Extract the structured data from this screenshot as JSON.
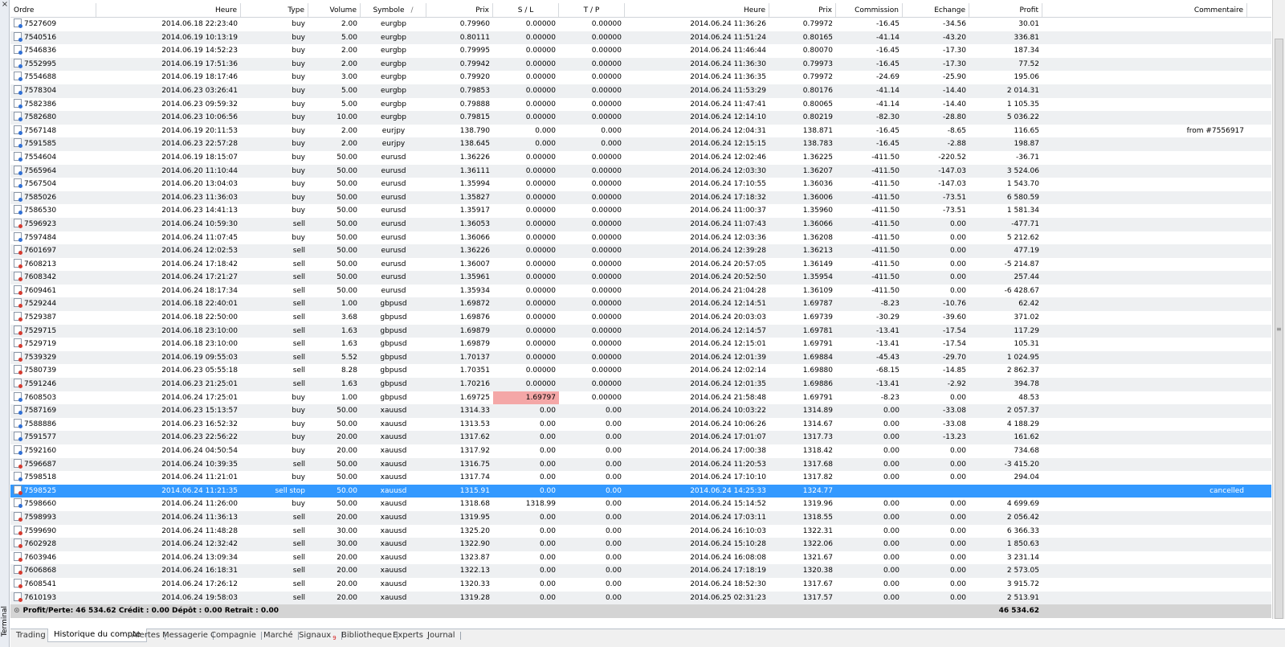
{
  "terminal_label": "Terminal",
  "columns": [
    "Ordre",
    "Heure",
    "Type",
    "Volume",
    "Symbole",
    "Prix",
    "S / L",
    "T / P",
    "Heure",
    "Prix",
    "Commission",
    "Echange",
    "Profit",
    "Commentaire"
  ],
  "rows": [
    {
      "order": "7527609",
      "open_time": "2014.06.18 22:23:40",
      "type": "buy",
      "volume": "2.00",
      "symbol": "eurgbp",
      "open_price": "0.79960",
      "sl": "0.00000",
      "tp": "0.00000",
      "close_time": "2014.06.24 11:36:26",
      "close_price": "0.79972",
      "commission": "-16.45",
      "swap": "-34.56",
      "profit": "30.01",
      "comment": ""
    },
    {
      "order": "7540516",
      "open_time": "2014.06.19 10:13:19",
      "type": "buy",
      "volume": "5.00",
      "symbol": "eurgbp",
      "open_price": "0.80111",
      "sl": "0.00000",
      "tp": "0.00000",
      "close_time": "2014.06.24 11:51:24",
      "close_price": "0.80165",
      "commission": "-41.14",
      "swap": "-43.20",
      "profit": "336.81",
      "comment": ""
    },
    {
      "order": "7546836",
      "open_time": "2014.06.19 14:52:23",
      "type": "buy",
      "volume": "2.00",
      "symbol": "eurgbp",
      "open_price": "0.79995",
      "sl": "0.00000",
      "tp": "0.00000",
      "close_time": "2014.06.24 11:46:44",
      "close_price": "0.80070",
      "commission": "-16.45",
      "swap": "-17.30",
      "profit": "187.34",
      "comment": ""
    },
    {
      "order": "7552995",
      "open_time": "2014.06.19 17:51:36",
      "type": "buy",
      "volume": "2.00",
      "symbol": "eurgbp",
      "open_price": "0.79942",
      "sl": "0.00000",
      "tp": "0.00000",
      "close_time": "2014.06.24 11:36:30",
      "close_price": "0.79973",
      "commission": "-16.45",
      "swap": "-17.30",
      "profit": "77.52",
      "comment": ""
    },
    {
      "order": "7554688",
      "open_time": "2014.06.19 18:17:46",
      "type": "buy",
      "volume": "3.00",
      "symbol": "eurgbp",
      "open_price": "0.79920",
      "sl": "0.00000",
      "tp": "0.00000",
      "close_time": "2014.06.24 11:36:35",
      "close_price": "0.79972",
      "commission": "-24.69",
      "swap": "-25.90",
      "profit": "195.06",
      "comment": ""
    },
    {
      "order": "7578304",
      "open_time": "2014.06.23 03:26:41",
      "type": "buy",
      "volume": "5.00",
      "symbol": "eurgbp",
      "open_price": "0.79853",
      "sl": "0.00000",
      "tp": "0.00000",
      "close_time": "2014.06.24 11:53:29",
      "close_price": "0.80176",
      "commission": "-41.14",
      "swap": "-14.40",
      "profit": "2 014.31",
      "comment": ""
    },
    {
      "order": "7582386",
      "open_time": "2014.06.23 09:59:32",
      "type": "buy",
      "volume": "5.00",
      "symbol": "eurgbp",
      "open_price": "0.79888",
      "sl": "0.00000",
      "tp": "0.00000",
      "close_time": "2014.06.24 11:47:41",
      "close_price": "0.80065",
      "commission": "-41.14",
      "swap": "-14.40",
      "profit": "1 105.35",
      "comment": ""
    },
    {
      "order": "7582680",
      "open_time": "2014.06.23 10:06:56",
      "type": "buy",
      "volume": "10.00",
      "symbol": "eurgbp",
      "open_price": "0.79815",
      "sl": "0.00000",
      "tp": "0.00000",
      "close_time": "2014.06.24 12:14:10",
      "close_price": "0.80219",
      "commission": "-82.30",
      "swap": "-28.80",
      "profit": "5 036.22",
      "comment": ""
    },
    {
      "order": "7567148",
      "open_time": "2014.06.19 20:11:53",
      "type": "buy",
      "volume": "2.00",
      "symbol": "eurjpy",
      "open_price": "138.790",
      "sl": "0.000",
      "tp": "0.000",
      "close_time": "2014.06.24 12:04:31",
      "close_price": "138.871",
      "commission": "-16.45",
      "swap": "-8.65",
      "profit": "116.65",
      "comment": "from #7556917"
    },
    {
      "order": "7591585",
      "open_time": "2014.06.23 22:57:28",
      "type": "buy",
      "volume": "2.00",
      "symbol": "eurjpy",
      "open_price": "138.645",
      "sl": "0.000",
      "tp": "0.000",
      "close_time": "2014.06.24 12:15:15",
      "close_price": "138.783",
      "commission": "-16.45",
      "swap": "-2.88",
      "profit": "198.87",
      "comment": ""
    },
    {
      "order": "7554604",
      "open_time": "2014.06.19 18:15:07",
      "type": "buy",
      "volume": "50.00",
      "symbol": "eurusd",
      "open_price": "1.36226",
      "sl": "0.00000",
      "tp": "0.00000",
      "close_time": "2014.06.24 12:02:46",
      "close_price": "1.36225",
      "commission": "-411.50",
      "swap": "-220.52",
      "profit": "-36.71",
      "comment": ""
    },
    {
      "order": "7565964",
      "open_time": "2014.06.20 11:10:44",
      "type": "buy",
      "volume": "50.00",
      "symbol": "eurusd",
      "open_price": "1.36111",
      "sl": "0.00000",
      "tp": "0.00000",
      "close_time": "2014.06.24 12:03:30",
      "close_price": "1.36207",
      "commission": "-411.50",
      "swap": "-147.03",
      "profit": "3 524.06",
      "comment": ""
    },
    {
      "order": "7567504",
      "open_time": "2014.06.20 13:04:03",
      "type": "buy",
      "volume": "50.00",
      "symbol": "eurusd",
      "open_price": "1.35994",
      "sl": "0.00000",
      "tp": "0.00000",
      "close_time": "2014.06.24 17:10:55",
      "close_price": "1.36036",
      "commission": "-411.50",
      "swap": "-147.03",
      "profit": "1 543.70",
      "comment": ""
    },
    {
      "order": "7585026",
      "open_time": "2014.06.23 11:36:03",
      "type": "buy",
      "volume": "50.00",
      "symbol": "eurusd",
      "open_price": "1.35827",
      "sl": "0.00000",
      "tp": "0.00000",
      "close_time": "2014.06.24 17:18:32",
      "close_price": "1.36006",
      "commission": "-411.50",
      "swap": "-73.51",
      "profit": "6 580.59",
      "comment": ""
    },
    {
      "order": "7586530",
      "open_time": "2014.06.23 14:41:13",
      "type": "buy",
      "volume": "50.00",
      "symbol": "eurusd",
      "open_price": "1.35917",
      "sl": "0.00000",
      "tp": "0.00000",
      "close_time": "2014.06.24 11:00:37",
      "close_price": "1.35960",
      "commission": "-411.50",
      "swap": "-73.51",
      "profit": "1 581.34",
      "comment": ""
    },
    {
      "order": "7596923",
      "open_time": "2014.06.24 10:59:30",
      "type": "sell",
      "volume": "50.00",
      "symbol": "eurusd",
      "open_price": "1.36053",
      "sl": "0.00000",
      "tp": "0.00000",
      "close_time": "2014.06.24 11:07:43",
      "close_price": "1.36066",
      "commission": "-411.50",
      "swap": "0.00",
      "profit": "-477.71",
      "comment": ""
    },
    {
      "order": "7597484",
      "open_time": "2014.06.24 11:07:45",
      "type": "buy",
      "volume": "50.00",
      "symbol": "eurusd",
      "open_price": "1.36066",
      "sl": "0.00000",
      "tp": "0.00000",
      "close_time": "2014.06.24 12:03:36",
      "close_price": "1.36208",
      "commission": "-411.50",
      "swap": "0.00",
      "profit": "5 212.62",
      "comment": ""
    },
    {
      "order": "7601697",
      "open_time": "2014.06.24 12:02:53",
      "type": "sell",
      "volume": "50.00",
      "symbol": "eurusd",
      "open_price": "1.36226",
      "sl": "0.00000",
      "tp": "0.00000",
      "close_time": "2014.06.24 12:39:28",
      "close_price": "1.36213",
      "commission": "-411.50",
      "swap": "0.00",
      "profit": "477.19",
      "comment": ""
    },
    {
      "order": "7608213",
      "open_time": "2014.06.24 17:18:42",
      "type": "sell",
      "volume": "50.00",
      "symbol": "eurusd",
      "open_price": "1.36007",
      "sl": "0.00000",
      "tp": "0.00000",
      "close_time": "2014.06.24 20:57:05",
      "close_price": "1.36149",
      "commission": "-411.50",
      "swap": "0.00",
      "profit": "-5 214.87",
      "comment": ""
    },
    {
      "order": "7608342",
      "open_time": "2014.06.24 17:21:27",
      "type": "sell",
      "volume": "50.00",
      "symbol": "eurusd",
      "open_price": "1.35961",
      "sl": "0.00000",
      "tp": "0.00000",
      "close_time": "2014.06.24 20:52:50",
      "close_price": "1.35954",
      "commission": "-411.50",
      "swap": "0.00",
      "profit": "257.44",
      "comment": ""
    },
    {
      "order": "7609461",
      "open_time": "2014.06.24 18:17:34",
      "type": "sell",
      "volume": "50.00",
      "symbol": "eurusd",
      "open_price": "1.35934",
      "sl": "0.00000",
      "tp": "0.00000",
      "close_time": "2014.06.24 21:04:28",
      "close_price": "1.36109",
      "commission": "-411.50",
      "swap": "0.00",
      "profit": "-6 428.67",
      "comment": ""
    },
    {
      "order": "7529244",
      "open_time": "2014.06.18 22:40:01",
      "type": "sell",
      "volume": "1.00",
      "symbol": "gbpusd",
      "open_price": "1.69872",
      "sl": "0.00000",
      "tp": "0.00000",
      "close_time": "2014.06.24 12:14:51",
      "close_price": "1.69787",
      "commission": "-8.23",
      "swap": "-10.76",
      "profit": "62.42",
      "comment": ""
    },
    {
      "order": "7529387",
      "open_time": "2014.06.18 22:50:00",
      "type": "sell",
      "volume": "3.68",
      "symbol": "gbpusd",
      "open_price": "1.69876",
      "sl": "0.00000",
      "tp": "0.00000",
      "close_time": "2014.06.24 20:03:03",
      "close_price": "1.69739",
      "commission": "-30.29",
      "swap": "-39.60",
      "profit": "371.02",
      "comment": ""
    },
    {
      "order": "7529715",
      "open_time": "2014.06.18 23:10:00",
      "type": "sell",
      "volume": "1.63",
      "symbol": "gbpusd",
      "open_price": "1.69879",
      "sl": "0.00000",
      "tp": "0.00000",
      "close_time": "2014.06.24 12:14:57",
      "close_price": "1.69781",
      "commission": "-13.41",
      "swap": "-17.54",
      "profit": "117.29",
      "comment": ""
    },
    {
      "order": "7529719",
      "open_time": "2014.06.18 23:10:00",
      "type": "sell",
      "volume": "1.63",
      "symbol": "gbpusd",
      "open_price": "1.69879",
      "sl": "0.00000",
      "tp": "0.00000",
      "close_time": "2014.06.24 12:15:01",
      "close_price": "1.69791",
      "commission": "-13.41",
      "swap": "-17.54",
      "profit": "105.31",
      "comment": ""
    },
    {
      "order": "7539329",
      "open_time": "2014.06.19 09:55:03",
      "type": "sell",
      "volume": "5.52",
      "symbol": "gbpusd",
      "open_price": "1.70137",
      "sl": "0.00000",
      "tp": "0.00000",
      "close_time": "2014.06.24 12:01:39",
      "close_price": "1.69884",
      "commission": "-45.43",
      "swap": "-29.70",
      "profit": "1 024.95",
      "comment": ""
    },
    {
      "order": "7580739",
      "open_time": "2014.06.23 05:55:18",
      "type": "sell",
      "volume": "8.28",
      "symbol": "gbpusd",
      "open_price": "1.70351",
      "sl": "0.00000",
      "tp": "0.00000",
      "close_time": "2014.06.24 12:02:14",
      "close_price": "1.69880",
      "commission": "-68.15",
      "swap": "-14.85",
      "profit": "2 862.37",
      "comment": ""
    },
    {
      "order": "7591246",
      "open_time": "2014.06.23 21:25:01",
      "type": "sell",
      "volume": "1.63",
      "symbol": "gbpusd",
      "open_price": "1.70216",
      "sl": "0.00000",
      "tp": "0.00000",
      "close_time": "2014.06.24 12:01:35",
      "close_price": "1.69886",
      "commission": "-13.41",
      "swap": "-2.92",
      "profit": "394.78",
      "comment": ""
    },
    {
      "order": "7608503",
      "open_time": "2014.06.24 17:25:01",
      "type": "buy",
      "volume": "1.00",
      "symbol": "gbpusd",
      "open_price": "1.69725",
      "sl": "1.69797",
      "sl_hit": true,
      "tp": "0.00000",
      "close_time": "2014.06.24 21:58:48",
      "close_price": "1.69791",
      "commission": "-8.23",
      "swap": "0.00",
      "profit": "48.53",
      "comment": ""
    },
    {
      "order": "7587169",
      "open_time": "2014.06.23 15:13:57",
      "type": "buy",
      "volume": "50.00",
      "symbol": "xauusd",
      "open_price": "1314.33",
      "sl": "0.00",
      "tp": "0.00",
      "close_time": "2014.06.24 10:03:22",
      "close_price": "1314.89",
      "commission": "0.00",
      "swap": "-33.08",
      "profit": "2 057.37",
      "comment": ""
    },
    {
      "order": "7588886",
      "open_time": "2014.06.23 16:52:32",
      "type": "buy",
      "volume": "50.00",
      "symbol": "xauusd",
      "open_price": "1313.53",
      "sl": "0.00",
      "tp": "0.00",
      "close_time": "2014.06.24 10:06:26",
      "close_price": "1314.67",
      "commission": "0.00",
      "swap": "-33.08",
      "profit": "4 188.29",
      "comment": ""
    },
    {
      "order": "7591577",
      "open_time": "2014.06.23 22:56:22",
      "type": "buy",
      "volume": "20.00",
      "symbol": "xauusd",
      "open_price": "1317.62",
      "sl": "0.00",
      "tp": "0.00",
      "close_time": "2014.06.24 17:01:07",
      "close_price": "1317.73",
      "commission": "0.00",
      "swap": "-13.23",
      "profit": "161.62",
      "comment": ""
    },
    {
      "order": "7592160",
      "open_time": "2014.06.24 04:50:54",
      "type": "buy",
      "volume": "20.00",
      "symbol": "xauusd",
      "open_price": "1317.92",
      "sl": "0.00",
      "tp": "0.00",
      "close_time": "2014.06.24 17:00:38",
      "close_price": "1318.42",
      "commission": "0.00",
      "swap": "0.00",
      "profit": "734.68",
      "comment": ""
    },
    {
      "order": "7596687",
      "open_time": "2014.06.24 10:39:35",
      "type": "sell",
      "volume": "50.00",
      "symbol": "xauusd",
      "open_price": "1316.75",
      "sl": "0.00",
      "tp": "0.00",
      "close_time": "2014.06.24 11:20:53",
      "close_price": "1317.68",
      "commission": "0.00",
      "swap": "0.00",
      "profit": "-3 415.20",
      "comment": ""
    },
    {
      "order": "7598518",
      "open_time": "2014.06.24 11:21:01",
      "type": "buy",
      "volume": "50.00",
      "symbol": "xauusd",
      "open_price": "1317.74",
      "sl": "0.00",
      "tp": "0.00",
      "close_time": "2014.06.24 17:10:10",
      "close_price": "1317.82",
      "commission": "0.00",
      "swap": "0.00",
      "profit": "294.04",
      "comment": ""
    },
    {
      "order": "7598525",
      "open_time": "2014.06.24 11:21:35",
      "type": "sell stop",
      "volume": "50.00",
      "symbol": "xauusd",
      "open_price": "1315.91",
      "sl": "0.00",
      "tp": "0.00",
      "close_time": "2014.06.24 14:25:33",
      "close_price": "1324.77",
      "commission": "",
      "swap": "",
      "profit": "",
      "comment": "cancelled",
      "selected": true
    },
    {
      "order": "7598660",
      "open_time": "2014.06.24 11:26:00",
      "type": "buy",
      "volume": "50.00",
      "symbol": "xauusd",
      "open_price": "1318.68",
      "sl": "1318.99",
      "tp": "0.00",
      "close_time": "2014.06.24 15:14:52",
      "close_price": "1319.96",
      "commission": "0.00",
      "swap": "0.00",
      "profit": "4 699.69",
      "comment": ""
    },
    {
      "order": "7598993",
      "open_time": "2014.06.24 11:36:13",
      "type": "sell",
      "volume": "20.00",
      "symbol": "xauusd",
      "open_price": "1319.95",
      "sl": "0.00",
      "tp": "0.00",
      "close_time": "2014.06.24 17:03:11",
      "close_price": "1318.55",
      "commission": "0.00",
      "swap": "0.00",
      "profit": "2 056.42",
      "comment": ""
    },
    {
      "order": "7599690",
      "open_time": "2014.06.24 11:48:28",
      "type": "sell",
      "volume": "30.00",
      "symbol": "xauusd",
      "open_price": "1325.20",
      "sl": "0.00",
      "tp": "0.00",
      "close_time": "2014.06.24 16:10:03",
      "close_price": "1322.31",
      "commission": "0.00",
      "swap": "0.00",
      "profit": "6 366.33",
      "comment": ""
    },
    {
      "order": "7602928",
      "open_time": "2014.06.24 12:32:42",
      "type": "sell",
      "volume": "30.00",
      "symbol": "xauusd",
      "open_price": "1322.90",
      "sl": "0.00",
      "tp": "0.00",
      "close_time": "2014.06.24 15:10:28",
      "close_price": "1322.06",
      "commission": "0.00",
      "swap": "0.00",
      "profit": "1 850.63",
      "comment": ""
    },
    {
      "order": "7603946",
      "open_time": "2014.06.24 13:09:34",
      "type": "sell",
      "volume": "20.00",
      "symbol": "xauusd",
      "open_price": "1323.87",
      "sl": "0.00",
      "tp": "0.00",
      "close_time": "2014.06.24 16:08:08",
      "close_price": "1321.67",
      "commission": "0.00",
      "swap": "0.00",
      "profit": "3 231.14",
      "comment": ""
    },
    {
      "order": "7606868",
      "open_time": "2014.06.24 16:18:31",
      "type": "sell",
      "volume": "20.00",
      "symbol": "xauusd",
      "open_price": "1322.13",
      "sl": "0.00",
      "tp": "0.00",
      "close_time": "2014.06.24 17:18:19",
      "close_price": "1320.38",
      "commission": "0.00",
      "swap": "0.00",
      "profit": "2 573.05",
      "comment": ""
    },
    {
      "order": "7608541",
      "open_time": "2014.06.24 17:26:12",
      "type": "sell",
      "volume": "20.00",
      "symbol": "xauusd",
      "open_price": "1320.33",
      "sl": "0.00",
      "tp": "0.00",
      "close_time": "2014.06.24 18:52:30",
      "close_price": "1317.67",
      "commission": "0.00",
      "swap": "0.00",
      "profit": "3 915.72",
      "comment": ""
    },
    {
      "order": "7610193",
      "open_time": "2014.06.24 19:58:03",
      "type": "sell",
      "volume": "20.00",
      "symbol": "xauusd",
      "open_price": "1319.28",
      "sl": "0.00",
      "tp": "0.00",
      "close_time": "2014.06.25 02:31:23",
      "close_price": "1317.57",
      "commission": "0.00",
      "swap": "0.00",
      "profit": "2 513.91",
      "comment": ""
    }
  ],
  "summary": {
    "text": "Profit/Perte: 46 534.62  Crédit : 0.00  Dépôt : 0.00  Retrait : 0.00",
    "total_profit": "46 534.62"
  },
  "tabs": [
    {
      "label": "Trading",
      "active": false
    },
    {
      "label": "Historique du compte",
      "active": true
    },
    {
      "label": "Alertes",
      "active": false
    },
    {
      "label": "Messagerie",
      "active": false
    },
    {
      "label": "Compagnie",
      "active": false
    },
    {
      "label": "Marché",
      "active": false
    },
    {
      "label": "Signaux",
      "active": false,
      "badge": "9"
    },
    {
      "label": "Bibliotheque",
      "active": false
    },
    {
      "label": "Experts",
      "active": false
    },
    {
      "label": "Journal",
      "active": false
    }
  ],
  "colors": {
    "selected_row": "#3399ff",
    "sl_highlight": "#f4a7a7",
    "alt_row": "#eef0f2",
    "buy_icon": "#2f6fd6",
    "sell_icon": "#d63a2f"
  }
}
